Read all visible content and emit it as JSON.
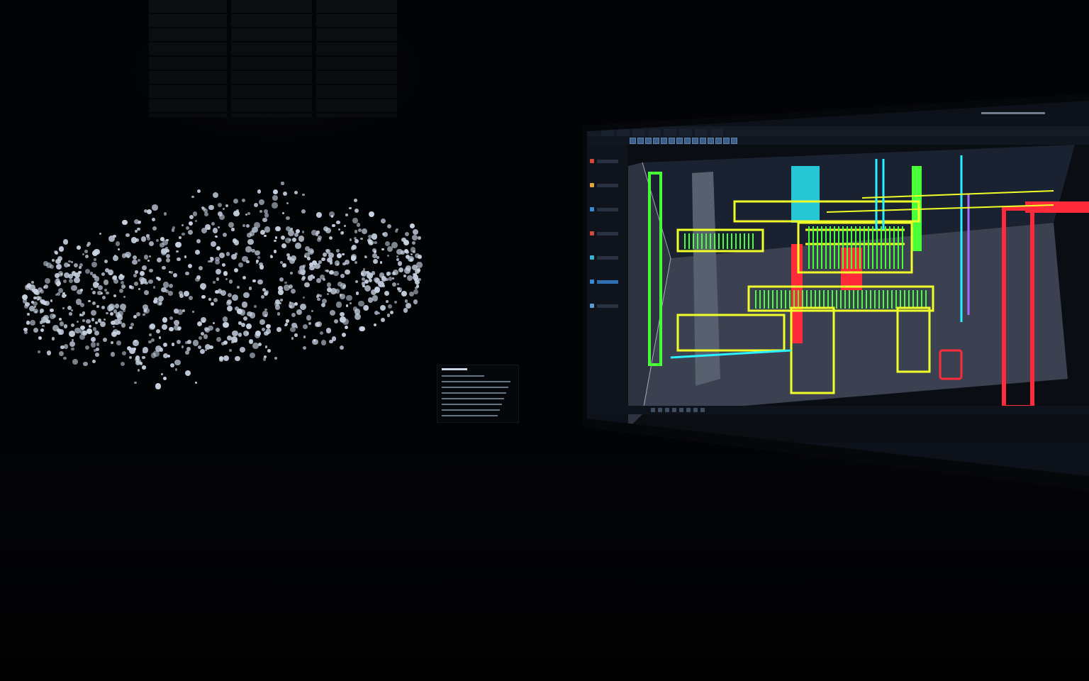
{
  "scene": {
    "description_colors": {
      "background": "#020305",
      "point_cloud": "#c7d2e2",
      "wireframe_green": "#49ff3a",
      "wireframe_yellow": "#f0ff2a",
      "wireframe_red": "#ff2a3a",
      "wireframe_cyan": "#2af0ff",
      "wireframe_purple": "#a46bff"
    }
  },
  "small_panel": {
    "title": "",
    "lines": [
      "",
      "",
      "",
      "",
      "",
      "",
      "",
      ""
    ]
  },
  "cad_app": {
    "title": "",
    "menu": [
      "",
      "",
      "",
      "",
      "",
      "",
      "",
      ""
    ],
    "toolbar_icons": [
      "select-icon",
      "move-icon",
      "rotate-icon",
      "scale-icon",
      "view-icon",
      "layers-icon",
      "render-icon",
      "measure-icon",
      "grid-icon",
      "snap-icon",
      "camera-icon",
      "light-icon",
      "settings-icon",
      "help-icon"
    ],
    "sidebar_icons": [
      "file-icon",
      "folder-icon",
      "layer-icon",
      "object-icon",
      "material-icon",
      "camera-icon",
      "light-icon"
    ],
    "status_text": "",
    "status_icons": [
      "grid-icon",
      "snap-icon",
      "ortho-icon",
      "polar-icon",
      "osnap-icon",
      "otrack-icon",
      "lineweight-icon",
      "model-icon"
    ]
  }
}
